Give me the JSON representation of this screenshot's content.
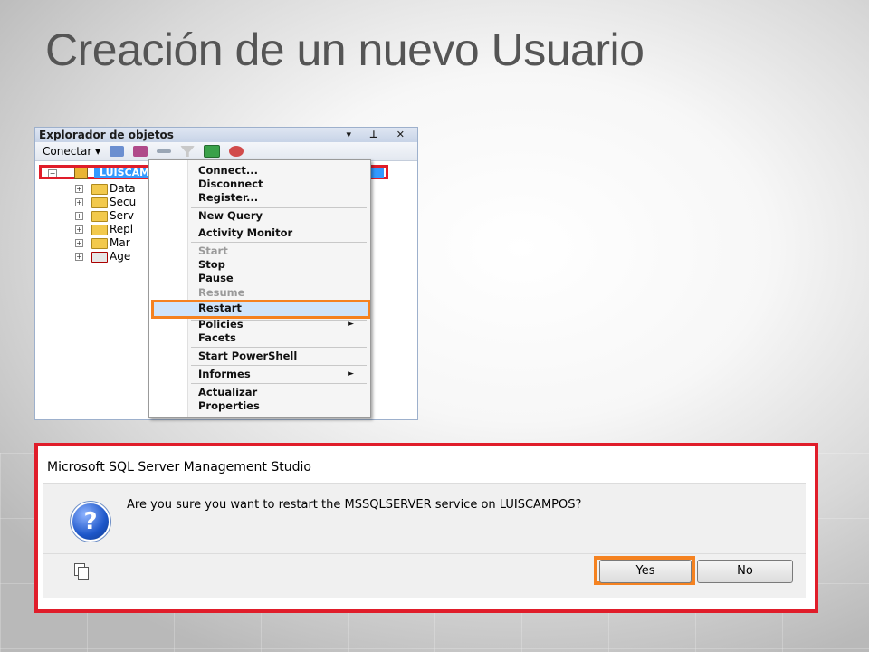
{
  "slide": {
    "title": "Creación de un nuevo Usuario"
  },
  "object_explorer": {
    "title": "Explorador de objetos",
    "title_controls": "▾ ⊥ ✕",
    "toolbar": {
      "connect_label": "Conectar ▾"
    },
    "root_node": {
      "label": "LUISCAMPOS (SQL Server 10.0.1600 - a)"
    },
    "tree_items": [
      {
        "label": "Data"
      },
      {
        "label": "Secu"
      },
      {
        "label": "Serv"
      },
      {
        "label": "Repl"
      },
      {
        "label": "Mar"
      },
      {
        "label": "Age"
      }
    ]
  },
  "context_menu": {
    "items": {
      "connect": "Connect...",
      "disconnect": "Disconnect",
      "register": "Register...",
      "new_query": "New Query",
      "activity_monitor": "Activity Monitor",
      "start": "Start",
      "stop": "Stop",
      "pause": "Pause",
      "resume": "Resume",
      "restart": "Restart",
      "policies": "Policies",
      "facets": "Facets",
      "start_powershell": "Start PowerShell",
      "informes": "Informes",
      "actualizar": "Actualizar",
      "properties": "Properties"
    },
    "submenu_arrow": "►"
  },
  "dialog": {
    "title": "Microsoft SQL Server Management Studio",
    "icon_glyph": "?",
    "message": "Are you sure you want to restart the MSSQLSERVER service on LUISCAMPOS?",
    "yes_label": "Yes",
    "no_label": "No"
  },
  "colors": {
    "highlight_red": "#e01d2a",
    "highlight_orange": "#f58220",
    "selection_blue": "#3399ff"
  }
}
